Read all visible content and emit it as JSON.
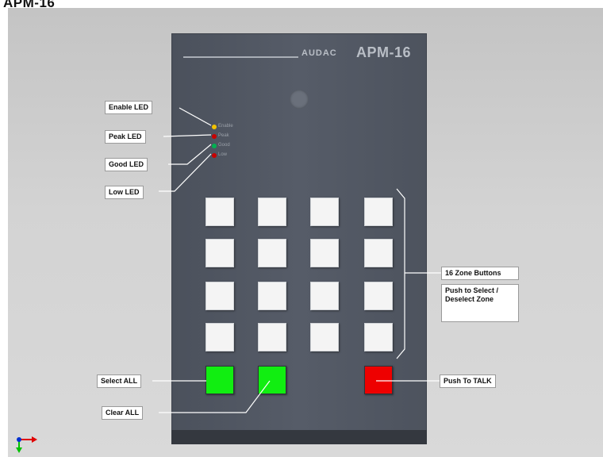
{
  "page": {
    "title": "APM-16"
  },
  "device": {
    "brand": "AUDAC",
    "model": "APM-16"
  },
  "leds": [
    {
      "key": "enable",
      "panel_label": "Enable",
      "color": "#f2c200"
    },
    {
      "key": "peak",
      "panel_label": "Peak",
      "color": "#c80000"
    },
    {
      "key": "good",
      "panel_label": "Good",
      "color": "#00b050"
    },
    {
      "key": "low",
      "panel_label": "Low",
      "color": "#c80000"
    }
  ],
  "callouts": {
    "enable_led": "Enable LED",
    "peak_led": "Peak LED",
    "good_led": "Good LED",
    "low_led": "Low LED",
    "zone_buttons": "16 Zone Buttons",
    "zone_action": "Push to Select / Deselect Zone",
    "select_all": "Select ALL",
    "clear_all": "Clear ALL",
    "push_to_talk": "Push To TALK"
  },
  "zone_grid": {
    "rows": 4,
    "columns": 4,
    "button_color": "#f4f4f4"
  },
  "action_buttons": {
    "select_all_color": "#11ee11",
    "clear_all_color": "#11ee11",
    "push_to_talk_color": "#ee0000"
  },
  "colors": {
    "panel": "#525864",
    "background": "#d0d0d0",
    "axis_x": "#e00000",
    "axis_y": "#00c000",
    "axis_origin": "#0030d0"
  }
}
